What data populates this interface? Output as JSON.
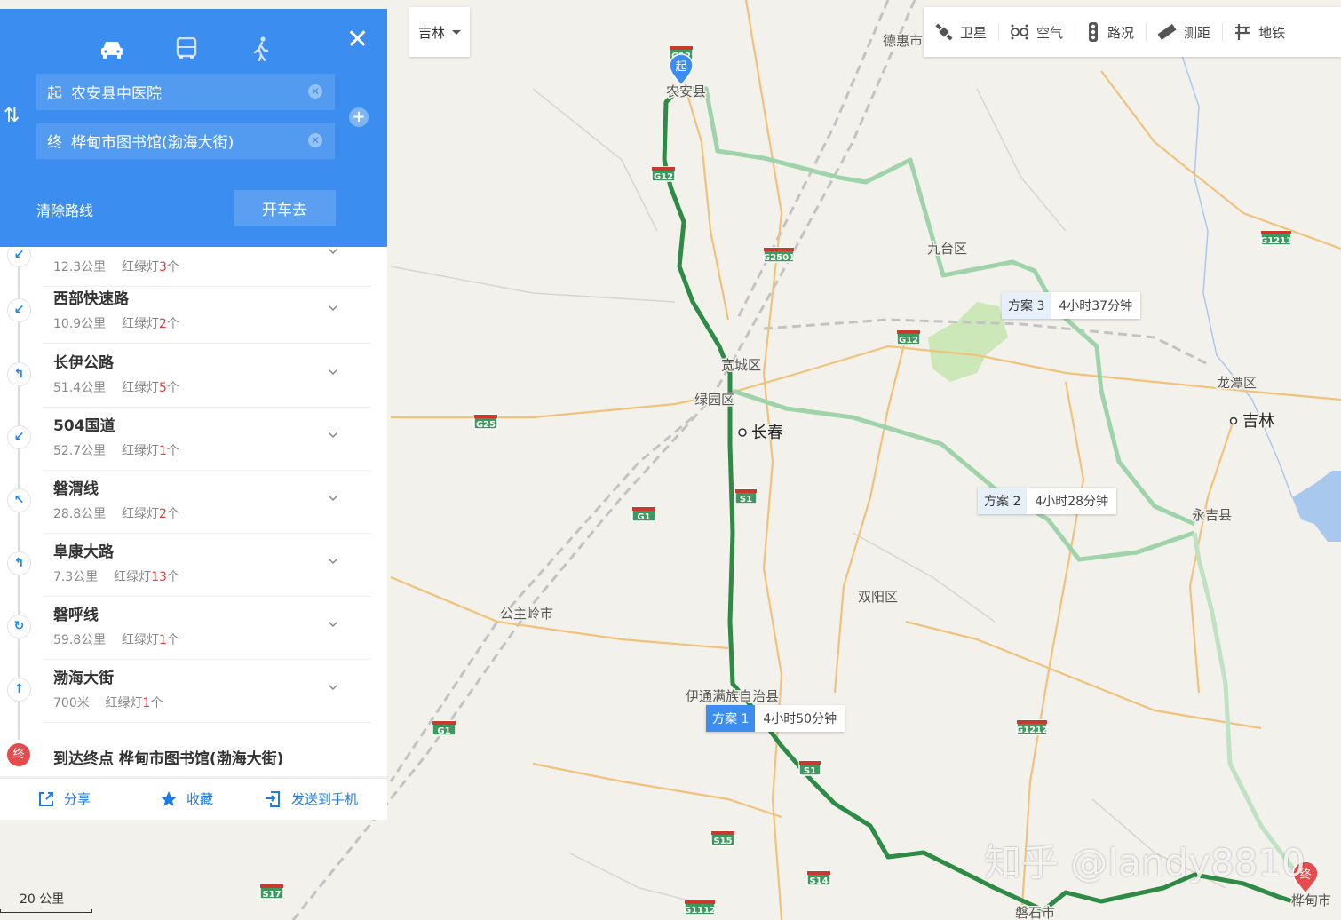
{
  "panel": {
    "modes": [
      {
        "name": "car",
        "icon": "car-icon"
      },
      {
        "name": "bus",
        "icon": "bus-icon"
      },
      {
        "name": "walk",
        "icon": "walk-icon"
      }
    ],
    "start_tag": "起",
    "start": "农安县中医院",
    "end_tag": "终",
    "end": "桦甸市图书馆(渤海大街)",
    "clear_route": "清除路线",
    "go": "开车去",
    "steps": [
      {
        "road": "",
        "distance": "12.3公里",
        "light_label": "红绿灯",
        "lights": "3",
        "unit": "个",
        "icon": "arrow-down-left-icon"
      },
      {
        "road": "西部快速路",
        "distance": "10.9公里",
        "light_label": "红绿灯",
        "lights": "2",
        "unit": "个",
        "icon": "arrow-down-left-icon"
      },
      {
        "road": "长伊公路",
        "distance": "51.4公里",
        "light_label": "红绿灯",
        "lights": "5",
        "unit": "个",
        "icon": "turn-left-icon"
      },
      {
        "road": "504国道",
        "distance": "52.7公里",
        "light_label": "红绿灯",
        "lights": "1",
        "unit": "个",
        "icon": "arrow-down-left-icon"
      },
      {
        "road": "磐渭线",
        "distance": "28.8公里",
        "light_label": "红绿灯",
        "lights": "2",
        "unit": "个",
        "icon": "arrow-up-left-icon"
      },
      {
        "road": "阜康大路",
        "distance": "7.3公里",
        "light_label": "红绿灯",
        "lights": "13",
        "unit": "个",
        "icon": "turn-left-icon"
      },
      {
        "road": "磐呼线",
        "distance": "59.8公里",
        "light_label": "红绿灯",
        "lights": "1",
        "unit": "个",
        "icon": "roundabout-icon"
      },
      {
        "road": "渤海大街",
        "distance": "700米",
        "light_label": "红绿灯",
        "lights": "1",
        "unit": "个",
        "icon": "arrow-up-icon"
      }
    ],
    "arrive_tag": "终",
    "arrive": "到达终点 桦甸市图书馆(渤海大街)",
    "share": "分享",
    "favorite": "收藏",
    "send": "发送到手机"
  },
  "city": "吉林",
  "toolbar": [
    {
      "label": "卫星",
      "icon": "satellite-icon"
    },
    {
      "label": "空气",
      "icon": "air-icon"
    },
    {
      "label": "路况",
      "icon": "traffic-light-icon"
    },
    {
      "label": "测距",
      "icon": "ruler-icon"
    },
    {
      "label": "地铁",
      "icon": "subway-icon"
    }
  ],
  "plans": [
    {
      "num": "方案 1",
      "time": "4小时50分钟"
    },
    {
      "num": "方案 2",
      "time": "4小时28分钟"
    },
    {
      "num": "方案 3",
      "time": "4小时37分钟"
    }
  ],
  "markers": {
    "start": "起",
    "end": "终"
  },
  "places": {
    "dehui": "德惠市",
    "nongan": "农安县",
    "jiutai": "九台区",
    "kuancheng": "宽城区",
    "lvyuan": "绿园区",
    "changchun": "长春",
    "longtan": "龙潭区",
    "jilin": "吉林",
    "yongji": "永吉县",
    "gongzhuling": "公主岭市",
    "shuangyang": "双阳区",
    "yitong": "伊通满族自治县",
    "panshi": "磐石市",
    "huadian": "桦甸市"
  },
  "highways": [
    "G12",
    "G12",
    "G2501",
    "G12",
    "G25",
    "S1",
    "G1",
    "G1211",
    "G1212",
    "G1",
    "S1",
    "S15",
    "S14",
    "G1112",
    "S17"
  ],
  "scale": "20 公里",
  "watermark": "知乎 @landy8810",
  "colors": {
    "panel": "#3c8df0",
    "route_main": "#2e8b45",
    "route_alt": "#8fcf9b",
    "highway": "#3c9a5e"
  }
}
